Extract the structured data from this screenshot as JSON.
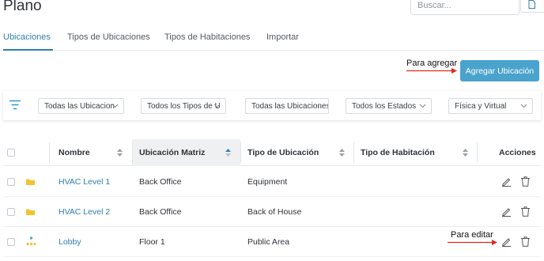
{
  "header": {
    "title": "Plano",
    "search_placeholder": "Buscar..."
  },
  "tabs": [
    {
      "label": "Ubicaciones",
      "active": true
    },
    {
      "label": "Tipos de Ubicaciones",
      "active": false
    },
    {
      "label": "Tipos de Habitaciones",
      "active": false
    },
    {
      "label": "Importar",
      "active": false
    }
  ],
  "annotations": {
    "add": "Para agregar",
    "edit": "Para editar",
    "arrow_color": "#e0281c"
  },
  "add_button": {
    "label": "Agregar Ubicación"
  },
  "filters": [
    {
      "label": "Todas las Ubicacion",
      "chevron": true
    },
    {
      "label": "Todos los Tipos de U",
      "chevron": true
    },
    {
      "label": "Todas las Ubicaciones",
      "chevron": false
    },
    {
      "label": "Todos los Estados",
      "chevron": true
    },
    {
      "label": "Física y Virtual",
      "chevron": true
    }
  ],
  "table": {
    "columns": {
      "name": "Nombre",
      "parent": "Ubicación Matriz",
      "type": "Tipo de Ubicación",
      "room_type": "Tipo de Habitación",
      "actions": "Acciones"
    },
    "rows": [
      {
        "icon": "folder-icon",
        "name": "HVAC Level 1",
        "parent": "Back Office",
        "type": "Equipment",
        "room_type": ""
      },
      {
        "icon": "folder-icon",
        "name": "HVAC Level 2",
        "parent": "Back Office",
        "type": "Back of House",
        "room_type": ""
      },
      {
        "icon": "hierarchy-icon",
        "name": "Lobby",
        "parent": "Floor 1",
        "type": "Public Area",
        "room_type": ""
      }
    ]
  },
  "colors": {
    "accent": "#2f7fae",
    "button": "#4aa3cc",
    "folder": "#f2c230"
  }
}
